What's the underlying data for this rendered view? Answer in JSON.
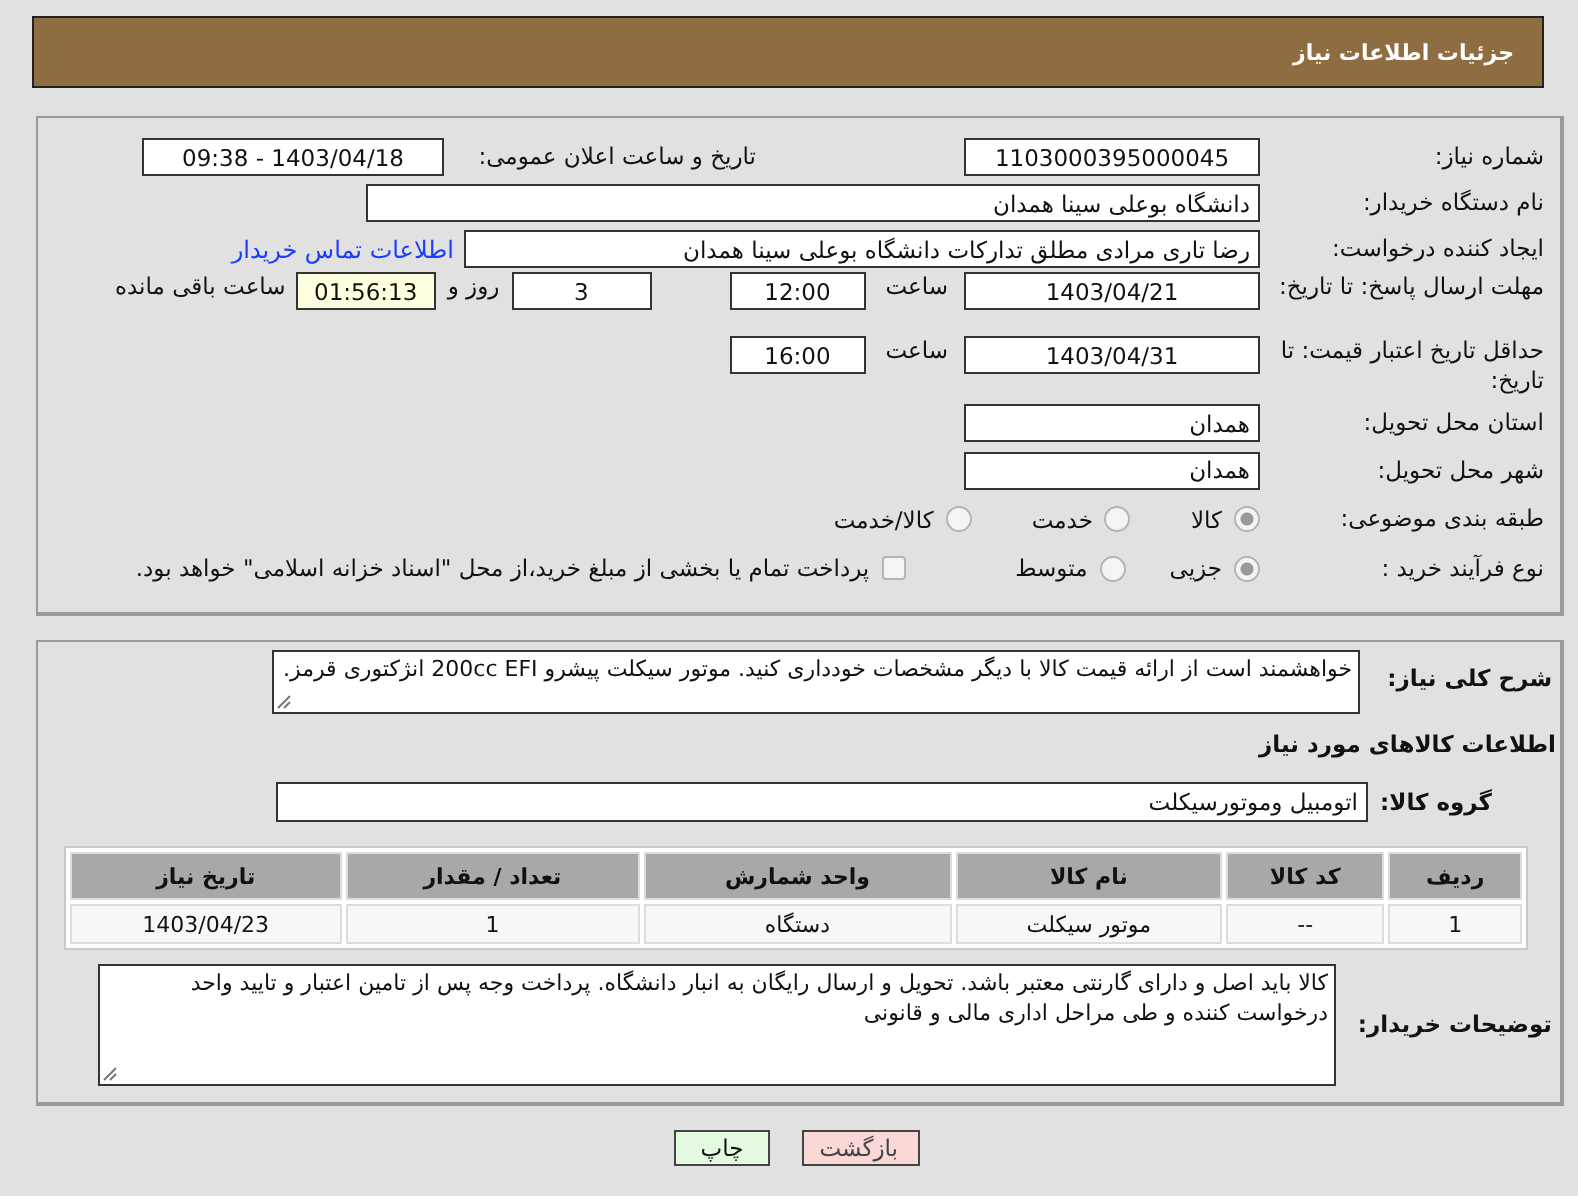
{
  "header": {
    "title": "جزئیات اطلاعات نیاز"
  },
  "need_number": {
    "label": "شماره نیاز:",
    "value": "1103000395000045"
  },
  "announce": {
    "label": "تاریخ و ساعت اعلان عمومی:",
    "value": "1403/04/18 - 09:38"
  },
  "buyer_org": {
    "label": "نام دستگاه خریدار:",
    "value": "دانشگاه بوعلی سینا همدان"
  },
  "requester": {
    "label": "ایجاد کننده درخواست:",
    "value": "رضا تاری مرادی مطلق تدارکات دانشگاه بوعلی سینا همدان",
    "link": "اطلاعات تماس خریدار"
  },
  "reply_deadline": {
    "label": "مهلت ارسال پاسخ: تا تاریخ:",
    "date": "1403/04/21",
    "time_label": "ساعت",
    "time": "12:00",
    "days": "3",
    "days_label": "روز و",
    "remaining": "01:56:13",
    "remaining_label": "ساعت باقی مانده"
  },
  "price_validity": {
    "label": "حداقل تاریخ اعتبار قیمت: تا تاریخ:",
    "date": "1403/04/31",
    "time_label": "ساعت",
    "time": "16:00"
  },
  "province": {
    "label": "استان محل تحویل:",
    "value": "همدان"
  },
  "city": {
    "label": "شهر محل تحویل:",
    "value": "همدان"
  },
  "category": {
    "label": "طبقه بندی موضوعی:",
    "options": [
      {
        "label": "کالا",
        "selected": true
      },
      {
        "label": "خدمت",
        "selected": false
      },
      {
        "label": "کالا/خدمت",
        "selected": false
      }
    ]
  },
  "process": {
    "label": "نوع فرآیند خرید :",
    "options": [
      {
        "label": "جزیی",
        "selected": true
      },
      {
        "label": "متوسط",
        "selected": false
      }
    ],
    "payment": {
      "label": "پرداخت تمام یا بخشی از مبلغ خرید،از محل \"اسناد خزانه اسلامی\" خواهد بود.",
      "checked": false
    }
  },
  "description": {
    "label": "شرح کلی نیاز:",
    "value": "خواهشمند است از ارائه قیمت کالا با دیگر مشخصات خودداری کنید.  موتور سیکلت پیشرو 200cc EFI انژکتوری قرمز."
  },
  "goods_heading": "اطلاعات کالاهای مورد نیاز",
  "goods_group": {
    "label": "گروه کالا:",
    "value": "اتومبیل وموتورسیکلت"
  },
  "table": {
    "columns": [
      "ردیف",
      "کد کالا",
      "نام کالا",
      "واحد شمارش",
      "تعداد / مقدار",
      "تاریخ نیاز"
    ],
    "rows": [
      [
        "1",
        "--",
        "موتور سیکلت",
        "دستگاه",
        "1",
        "1403/04/23"
      ]
    ]
  },
  "buyer_notes": {
    "label": "توضیحات خریدار:",
    "value": "کالا باید اصل و دارای گارنتی معتبر باشد. تحویل و ارسال رایگان به انبار دانشگاه. پرداخت وجه پس از تامین اعتبار و تایید واحد درخواست کننده و طی مراحل اداری مالی و قانونی"
  },
  "buttons": [
    {
      "label": "بازگشت",
      "kind": "back"
    },
    {
      "label": "چاپ",
      "kind": "print"
    }
  ]
}
